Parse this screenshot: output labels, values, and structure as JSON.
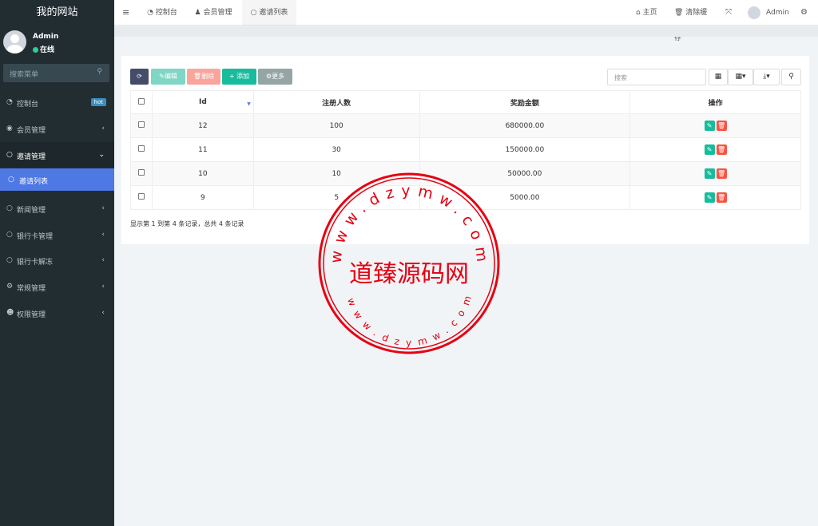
{
  "app": {
    "title": "我的网站"
  },
  "user": {
    "name": "Admin",
    "status": "在线"
  },
  "sidebar": {
    "search_placeholder": "搜索菜单",
    "items": [
      {
        "label": "控制台",
        "icon": "dashboard-icon",
        "badge": "hot"
      },
      {
        "label": "会员管理",
        "icon": "user-circle-icon"
      },
      {
        "label": "邀请管理",
        "icon": "circle-icon"
      },
      {
        "label": "邀请列表",
        "icon": "circle-icon"
      },
      {
        "label": "新闻管理",
        "icon": "circle-icon"
      },
      {
        "label": "银行卡管理",
        "icon": "circle-icon"
      },
      {
        "label": "银行卡解冻",
        "icon": "circle-icon"
      },
      {
        "label": "常规管理",
        "icon": "cogs-icon"
      },
      {
        "label": "权限管理",
        "icon": "users-icon"
      }
    ]
  },
  "topbar": {
    "tabs": [
      {
        "label": "控制台",
        "icon": "dashboard-icon"
      },
      {
        "label": "会员管理",
        "icon": "user-icon"
      },
      {
        "label": "邀请列表",
        "icon": "circle-icon"
      }
    ],
    "home": "主页",
    "clear_cache": "清除缓存",
    "admin": "Admin"
  },
  "toolbar": {
    "edit": "编辑",
    "delete": "删除",
    "add": "添加",
    "more": "更多",
    "search_placeholder": "搜索"
  },
  "table": {
    "columns": [
      "Id",
      "注册人数",
      "奖励金额",
      "操作"
    ],
    "rows": [
      {
        "id": "12",
        "count": "100",
        "amount": "680000.00"
      },
      {
        "id": "11",
        "count": "30",
        "amount": "150000.00"
      },
      {
        "id": "10",
        "count": "10",
        "amount": "50000.00"
      },
      {
        "id": "9",
        "count": "5",
        "amount": "5000.00"
      }
    ]
  },
  "pagination": {
    "info": "显示第 1 到第 4 条记录，总共 4 条记录"
  },
  "watermark": {
    "text": "道臻源码网",
    "ring_top": "www.dzymw.com",
    "ring_bottom": "www.dzymw.com"
  },
  "colors": {
    "sidebar": "#222d32",
    "active": "#4e78e4",
    "edit": "#18bc9c",
    "delete": "#f75444",
    "add": "#18bc9c",
    "refresh": "#444c69",
    "stamp": "#e60012"
  }
}
